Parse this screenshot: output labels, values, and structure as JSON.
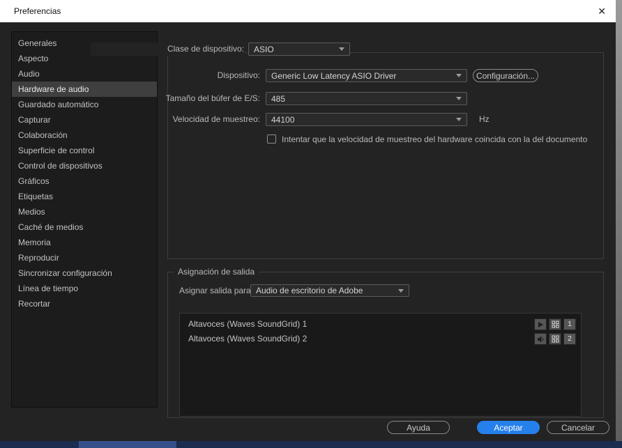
{
  "window": {
    "title": "Preferencias",
    "close_glyph": "✕"
  },
  "sidebar": {
    "items": [
      "Generales",
      "Aspecto",
      "Audio",
      "Hardware de audio",
      "Guardado automático",
      "Capturar",
      "Colaboración",
      "Superficie de control",
      "Control de dispositivos",
      "Gráficos",
      "Etiquetas",
      "Medios",
      "Caché de medios",
      "Memoria",
      "Reproducir",
      "Sincronizar configuración",
      "Línea de tiempo",
      "Recortar"
    ],
    "selected": "Hardware de audio"
  },
  "audio_hardware": {
    "device_class_label": "Clase de dispositivo:",
    "device_class_value": "ASIO",
    "device_label": "Dispositivo:",
    "device_value": "Generic Low Latency ASIO Driver",
    "settings_button": "Configuración...",
    "buffer_label": "Tamaño del búfer de E/S:",
    "buffer_value": "485",
    "samplerate_label": "Velocidad de muestreo:",
    "samplerate_value": "44100",
    "samplerate_unit": "Hz",
    "match_checkbox_label": "Intentar que la velocidad de muestreo del hardware coincida con la del documento",
    "match_checkbox_checked": false
  },
  "output_mapping": {
    "legend": "Asignación de salida",
    "assign_label": "Asignar salida para:",
    "assign_value": "Audio de escritorio de Adobe",
    "outputs": [
      {
        "name": "Altavoces (Waves SoundGrid) 1",
        "number": "1"
      },
      {
        "name": "Altavoces (Waves SoundGrid) 2",
        "number": "2"
      }
    ]
  },
  "footer": {
    "help": "Ayuda",
    "ok": "Aceptar",
    "cancel": "Cancelar"
  },
  "colors": {
    "accent": "#2680eb",
    "dialog_bg": "#232323",
    "sidebar_bg": "#1c1c1c",
    "titlebar_bg": "#ffffff"
  }
}
